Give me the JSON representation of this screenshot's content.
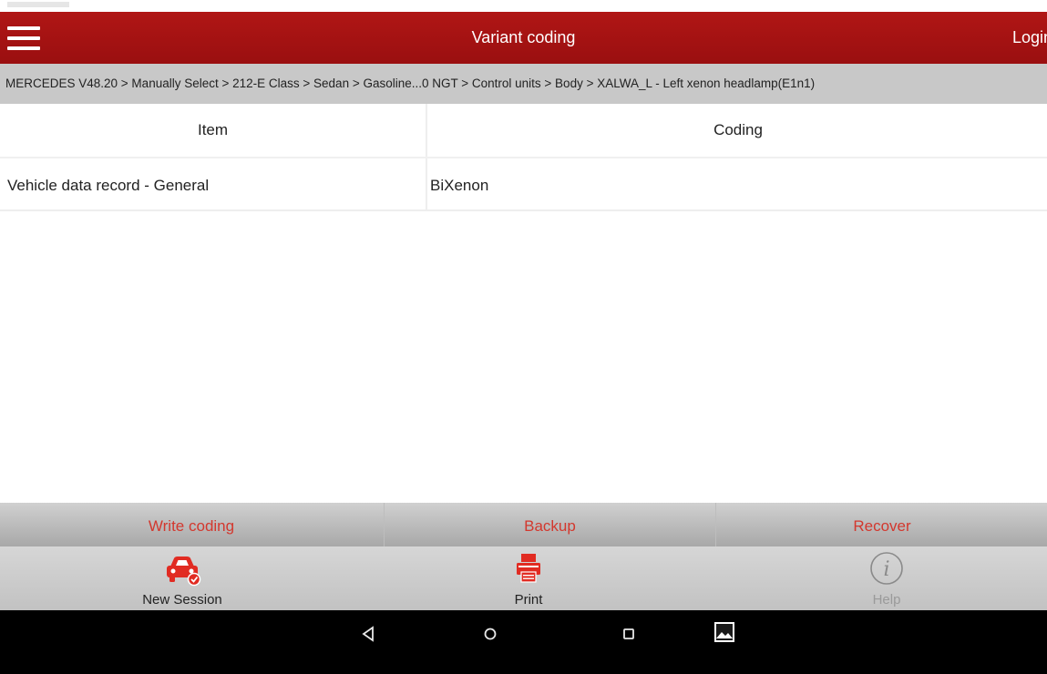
{
  "header": {
    "title": "Variant coding",
    "login_label": "Login"
  },
  "breadcrumb": "MERCEDES V48.20 > Manually Select > 212-E Class > Sedan > Gasoline...0 NGT > Control units > Body > XALWA_L - Left xenon headlamp(E1n1)",
  "table": {
    "columns": [
      "Item",
      "Coding"
    ],
    "rows": [
      {
        "item": "Vehicle data record - General",
        "coding": "BiXenon"
      }
    ]
  },
  "actions": {
    "write_coding": "Write coding",
    "backup": "Backup",
    "recover": "Recover"
  },
  "toolbar": {
    "new_session": "New Session",
    "print": "Print",
    "help": "Help"
  },
  "colors": {
    "header_bg": "#a81313",
    "action_text": "#d3382e",
    "icon_red": "#e12b22",
    "disabled_text": "#9a9a9a"
  },
  "icons": {
    "menu": "hamburger-icon",
    "new_session": "car-icon",
    "print": "printer-icon",
    "help": "info-icon",
    "nav_back": "back-triangle-icon",
    "nav_home": "home-circle-icon",
    "nav_recent": "recent-square-icon",
    "nav_screenshot": "gallery-icon"
  }
}
